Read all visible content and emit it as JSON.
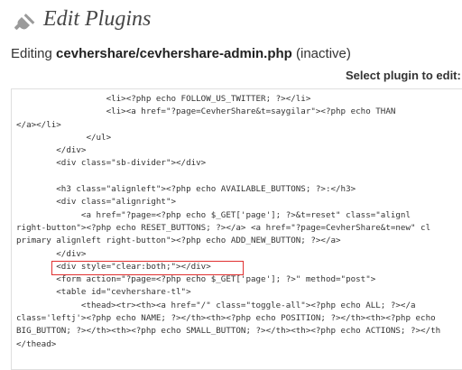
{
  "page": {
    "title": "Edit Plugins",
    "editing_prefix": "Editing ",
    "editing_file": "cevhershare/cevhershare-admin.php",
    "editing_status": " (inactive)",
    "select_plugin_label": "Select plugin to edit:"
  },
  "editor": {
    "lines": [
      "                  <li><?php echo FOLLOW_US_TWITTER; ?></li>",
      "                  <li><a href=\"?page=CevherShare&t=saygilar\"><?php echo THAN",
      "</a></li>",
      "              </ul>",
      "        </div>",
      "        <div class=\"sb-divider\"></div>",
      "",
      "        <h3 class=\"alignleft\"><?php echo AVAILABLE_BUTTONS; ?>:</h3>",
      "        <div class=\"alignright\">",
      "             <a href=\"?page=<?php echo $_GET['page']; ?>&t=reset\" class=\"alignl",
      "right-button\"><?php echo RESET_BUTTONS; ?></a> <a href=\"?page=CevherShare&t=new\" cl",
      "primary alignleft right-button\"><?php echo ADD_NEW_BUTTON; ?></a>",
      "        </div>",
      "        <div style=\"clear:both;\"></div>",
      "        <form action=\"?page=<?php echo $_GET['page']; ?>\" method=\"post\">",
      "        <table id=\"cevhershare-tl\">",
      "             <thead><tr><th><a href=\"/\" class=\"toggle-all\"><?php echo ALL; ?></a",
      "class='leftj'><?php echo NAME; ?></th><th><?php echo POSITION; ?></th><th><?php echo",
      "BIG_BUTTON; ?></th><th><?php echo SMALL_BUTTON; ?></th><th><?php echo ACTIONS; ?></th",
      "</thead>"
    ]
  },
  "colors": {
    "highlight_border": "#e03030",
    "title": "#464646"
  }
}
